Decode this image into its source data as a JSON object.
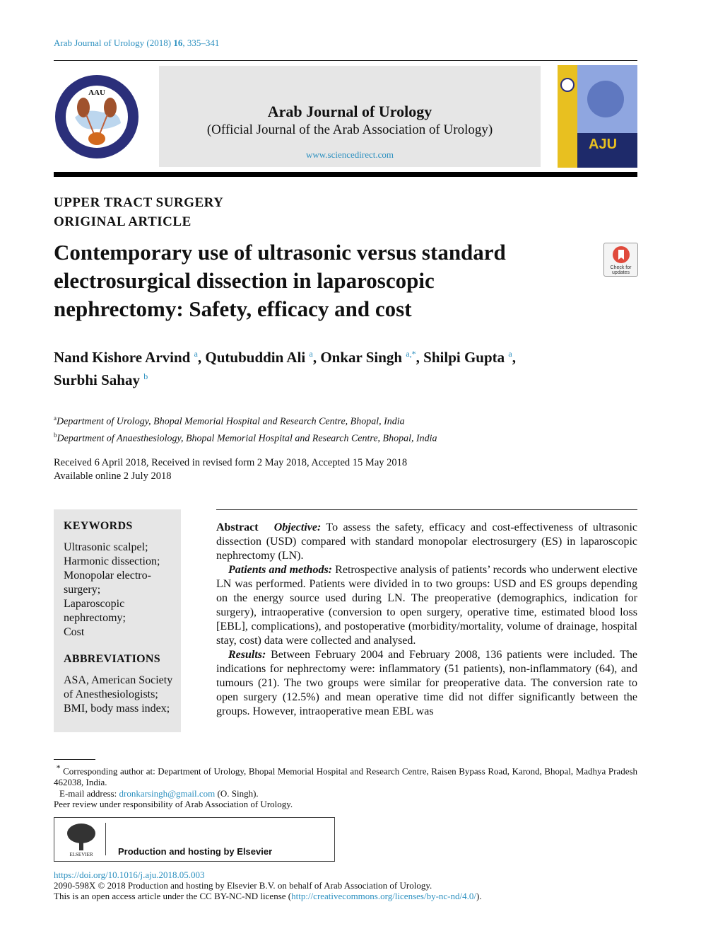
{
  "header": {
    "citation_pre": "Arab Journal of Urology (2018) ",
    "citation_vol": "16",
    "citation_post": ", 335–341",
    "journal_title": "Arab Journal of Urology",
    "journal_subtitle": "(Official Journal of the Arab Association of Urology)",
    "journal_url": "www.sciencedirect.com",
    "logo_text": "AAU",
    "cover_text": "AJU"
  },
  "sections": [
    "UPPER TRACT SURGERY",
    "ORIGINAL ARTICLE"
  ],
  "title": "Contemporary use of ultrasonic versus standard electrosurgical dissection in laparoscopic nephrectomy: Safety, efficacy and cost",
  "check_updates": "Check for updates",
  "authors": [
    {
      "name": "Nand Kishore Arvind",
      "sup": "a"
    },
    {
      "name": "Qutubuddin Ali",
      "sup": "a"
    },
    {
      "name": "Onkar Singh",
      "sup": "a,*"
    },
    {
      "name": "Shilpi Gupta",
      "sup": "a"
    },
    {
      "name": "Surbhi Sahay",
      "sup": "b"
    }
  ],
  "affiliations": [
    {
      "sup": "a",
      "text": "Department of Urology, Bhopal Memorial Hospital and Research Centre, Bhopal, India"
    },
    {
      "sup": "b",
      "text": "Department of Anaesthesiology, Bhopal Memorial Hospital and Research Centre, Bhopal, India"
    }
  ],
  "dates": [
    "Received 6 April 2018, Received in revised form 2 May 2018, Accepted 15 May 2018",
    "Available online 2 July 2018"
  ],
  "keywords": {
    "heading": "KEYWORDS",
    "items": [
      "Ultrasonic scalpel;",
      "Harmonic dissection;",
      "Monopolar electro-surgery;",
      "Laparoscopic nephrectomy;",
      "Cost"
    ]
  },
  "abbreviations": {
    "heading": "ABBREVIATIONS",
    "items": [
      "ASA, American Society of Anesthesiologists;",
      "BMI, body mass index;"
    ]
  },
  "abstract": {
    "label": "Abstract",
    "paragraphs": [
      {
        "head": "Objective:",
        "text": " To assess the safety, efficacy and cost-effectiveness of ultrasonic dissection (USD) compared with standard monopolar electrosurgery (ES) in laparoscopic nephrectomy (LN)."
      },
      {
        "head": "Patients and methods:",
        "text": " Retrospective analysis of patients’ records who underwent elective LN was performed. Patients were divided in to two groups: USD and ES groups depending on the energy source used during LN. The preoperative (demographics, indication for surgery), intraoperative (conversion to open surgery, operative time, estimated blood loss [EBL], complications), and postoperative (morbidity/mortality, volume of drainage, hospital stay, cost) data were collected and analysed."
      },
      {
        "head": "Results:",
        "text": " Between February 2004 and February 2008, 136 patients were included. The indications for nephrectomy were: inflammatory (51 patients), non-inflammatory (64), and tumours (21). The two groups were similar for preoperative data. The conversion rate to open surgery (12.5%) and mean operative time did not differ significantly between the groups. However, intraoperative mean EBL was"
      }
    ]
  },
  "footnote": {
    "mark": "*",
    "text": "Corresponding author at: Department of Urology, Bhopal Memorial Hospital and Research Centre, Raisen Bypass Road, Karond, Bhopal, Madhya Pradesh 462038, India.",
    "email_label": "E-mail address: ",
    "email": "dronkarsingh@gmail.com",
    "email_post": " (O. Singh)."
  },
  "peer_review": "Peer review under responsibility of Arab Association of Urology.",
  "elsevier": {
    "logo_text": "ELSEVIER",
    "text": "Production and hosting by Elsevier"
  },
  "bottom": {
    "doi": "https://doi.org/10.1016/j.aju.2018.05.003",
    "copyright": "2090-598X © 2018 Production and hosting by Elsevier B.V. on behalf of Arab Association of Urology.",
    "license_pre": "This is an open access article under the CC BY-NC-ND license (",
    "license_url": "http://creativecommons.org/licenses/by-nc-nd/4.0/",
    "license_post": ")."
  },
  "colors": {
    "link": "#2a8fbf",
    "banner": "#e6e6e6",
    "cover_yellow": "#e8c020",
    "cover_navy": "#1e2a6a"
  }
}
